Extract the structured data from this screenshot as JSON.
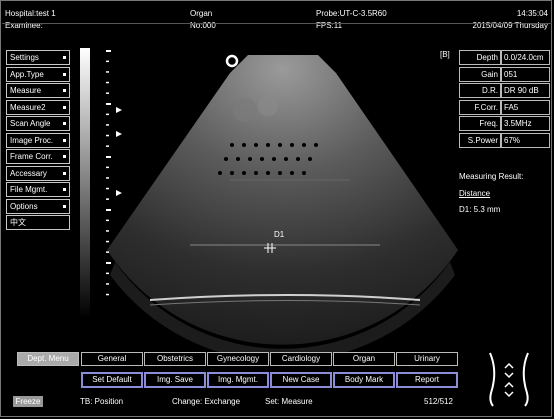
{
  "header": {
    "hospital": "Hospital:test 1",
    "examinee": "Examinee:",
    "organ": "Organ",
    "number": "No:000",
    "probe": "Probe:UT-C-3.5R60",
    "fps": "FPS:11",
    "time": "14:35:04",
    "date": "2015/04/09 Thursday"
  },
  "left_menu": [
    {
      "label": "Settings",
      "marker": true
    },
    {
      "label": "App.Type",
      "marker": true
    },
    {
      "label": "Measure",
      "marker": true
    },
    {
      "label": "Measure2",
      "marker": true
    },
    {
      "label": "Scan Angle",
      "marker": true
    },
    {
      "label": "Image Proc.",
      "marker": true
    },
    {
      "label": "Frame Corr.",
      "marker": true
    },
    {
      "label": "Accessary",
      "marker": true
    },
    {
      "label": "File Mgmt.",
      "marker": true
    },
    {
      "label": "Options",
      "marker": true
    },
    {
      "label": "中文",
      "marker": false
    }
  ],
  "image": {
    "mode_tag": "[B]",
    "measure_label": "D1"
  },
  "params": [
    {
      "label": "Depth",
      "value": "0.0/24.0cm"
    },
    {
      "label": "Gain",
      "value": "051"
    },
    {
      "label": "D.R.",
      "value": "DR 90 dB"
    },
    {
      "label": "F.Corr.",
      "value": "FA5"
    },
    {
      "label": "Freq.",
      "value": "3.5MHz"
    },
    {
      "label": "S.Power",
      "value": "67%"
    }
  ],
  "measure_result": {
    "title": "Measuring Result:",
    "type": "Distance",
    "value": "D1: 5.3 mm"
  },
  "tabs": [
    {
      "label": "Dept. Menu",
      "active": true
    },
    {
      "label": "General",
      "active": false
    },
    {
      "label": "Obstetrics",
      "active": false
    },
    {
      "label": "Gynecology",
      "active": false
    },
    {
      "label": "Cardiology",
      "active": false
    },
    {
      "label": "Organ",
      "active": false
    },
    {
      "label": "Urinary",
      "active": false
    }
  ],
  "buttons": [
    "Set Default",
    "Img. Save",
    "Img. Mgmt.",
    "New Case",
    "Body Mark",
    "Report"
  ],
  "status": {
    "freeze": "Freeze",
    "tb": "TB: Position",
    "change": "Change: Exchange",
    "set": "Set: Measure",
    "frames": "512/512"
  },
  "colors": {
    "button_border": "#8c8cd8",
    "active_tab": "#aaaaaa"
  }
}
